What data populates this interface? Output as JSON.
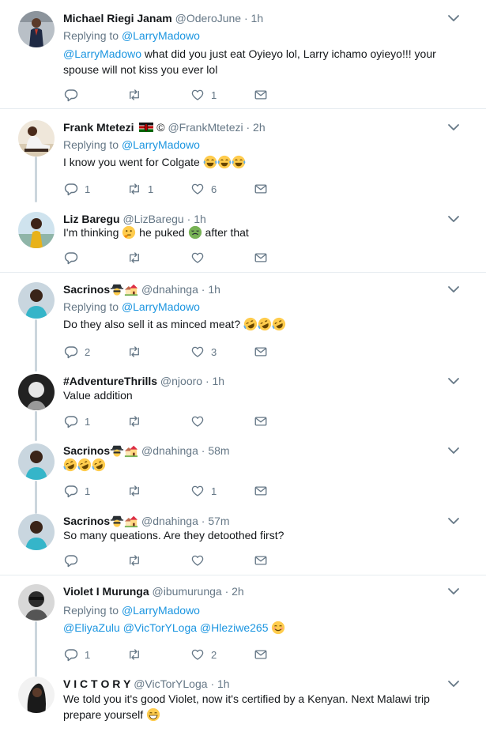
{
  "tweets": [
    {
      "name": "Michael Riegi Janam",
      "handle": "@OderoJune",
      "time": "1h",
      "reply_label": "Replying to",
      "reply_to": "@LarryMadowo",
      "mention": "@LarryMadowo",
      "text": " what did you just eat Oyieyo lol, Larry ichamo oyieyo!!! your spouse will not kiss you ever lol",
      "replies": "",
      "retweets": "",
      "likes": "1"
    },
    {
      "name": "Frank Mtetezi",
      "name_suffix": "©",
      "handle": "@FrankMtetezi",
      "time": "2h",
      "reply_label": "Replying to",
      "reply_to": "@LarryMadowo",
      "text": "I know you went for Colgate",
      "replies": "1",
      "retweets": "1",
      "likes": "6"
    },
    {
      "name": "Liz Baregu",
      "handle": "@LizBaregu",
      "time": "1h",
      "text_a": "I'm thinking",
      "text_b": "he puked",
      "text_c": "after that",
      "replies": "",
      "retweets": "",
      "likes": ""
    },
    {
      "name": "Sacrinos",
      "handle": "@dnahinga",
      "time": "1h",
      "reply_label": "Replying to",
      "reply_to": "@LarryMadowo",
      "text": "Do they also sell it as minced meat?",
      "replies": "2",
      "retweets": "",
      "likes": "3"
    },
    {
      "name": "#AdventureThrills",
      "handle": "@njooro",
      "time": "1h",
      "text": "Value addition",
      "replies": "1",
      "retweets": "",
      "likes": ""
    },
    {
      "name": "Sacrinos",
      "handle": "@dnahinga",
      "time": "58m",
      "replies": "1",
      "retweets": "",
      "likes": "1"
    },
    {
      "name": "Sacrinos",
      "handle": "@dnahinga",
      "time": "57m",
      "text": "So many queations. Are they detoothed first?",
      "replies": "",
      "retweets": "",
      "likes": ""
    },
    {
      "name": "Violet I Murunga",
      "handle": "@ibumurunga",
      "time": "2h",
      "reply_label": "Replying to",
      "reply_to": "@LarryMadowo",
      "mentions": [
        "@EliyaZulu",
        "@VicTorYLoga",
        "@Hleziwe265"
      ],
      "replies": "1",
      "retweets": "",
      "likes": "2"
    },
    {
      "name": "V I C T O R Y",
      "handle": "@VicTorYLoga",
      "time": "1h",
      "text": "We told you it's good Violet, now it's certified by a Kenyan. Next Malawi trip prepare yourself",
      "replies": "",
      "retweets": "",
      "likes": ""
    }
  ],
  "separator": "·",
  "icons": {
    "reply": "reply-icon",
    "retweet": "retweet-icon",
    "like": "heart-icon",
    "dm": "envelope-icon",
    "more": "chevron-down-icon",
    "emoji": [
      "tears-of-joy-emoji",
      "thinking-emoji",
      "nauseated-emoji",
      "rofl-emoji",
      "smiling-emoji",
      "grinning-emoji",
      "spy-emoji",
      "houses-emoji",
      "kenya-flag"
    ]
  },
  "colors": {
    "link": "#1b95e0",
    "muted": "#657786",
    "text": "#14171a",
    "thread_line": "#ccd6dd",
    "divider": "#e6ecf0"
  }
}
